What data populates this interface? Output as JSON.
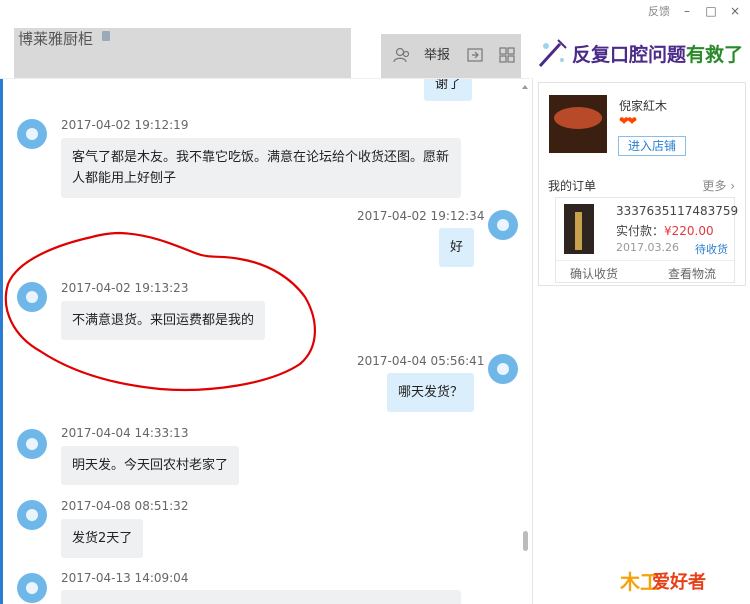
{
  "window": {
    "feedback": "反馈",
    "min": "–",
    "max": "□",
    "close": "×"
  },
  "header": {
    "title": "博莱雅厨柜",
    "report": "举报"
  },
  "banner": {
    "text_a": "反复口腔问题",
    "text_b": "有救了"
  },
  "messages": [
    {
      "side": "me",
      "text": "谢了"
    },
    {
      "side": "them",
      "time": "2017-04-02 19:12:19",
      "text": "客气了都是木友。我不靠它吃饭。满意在论坛给个收货还图。愿新人都能用上好刨子"
    },
    {
      "side": "me",
      "time": "2017-04-02 19:12:34",
      "text": "好"
    },
    {
      "side": "them",
      "time": "2017-04-02 19:13:23",
      "text": "不满意退货。来回运费都是我的"
    },
    {
      "side": "me",
      "time": "2017-04-04 05:56:41",
      "text": "哪天发货？"
    },
    {
      "side": "them",
      "time": "2017-04-04 14:33:13",
      "text": "明天发。今天回农村老家了"
    },
    {
      "side": "them",
      "time": "2017-04-08 08:51:32",
      "text": "发货2天了"
    },
    {
      "side": "them",
      "time": "2017-04-13 14:09:04",
      "text": ""
    }
  ],
  "panel": {
    "shop_name": "倪家紅木",
    "hearts": "❤❤",
    "enter_store": "进入店铺",
    "orders_title": "我的订单",
    "more": "更多 ›",
    "order": {
      "id": "3337635117483759",
      "pay_label": "实付款：",
      "pay_value": "¥220.00",
      "date": "2017.03.26",
      "status": "待收货",
      "confirm": "确认收货",
      "logistics": "查看物流"
    }
  },
  "watermark": {
    "a": "木工",
    "b": "爱好者"
  },
  "colors": {
    "accent": "#2b7cd3",
    "annotation": "#e00000",
    "avatar": "#6fb7e9",
    "bubble_me": "#dbeefb",
    "bubble_them": "#eef0f2"
  }
}
